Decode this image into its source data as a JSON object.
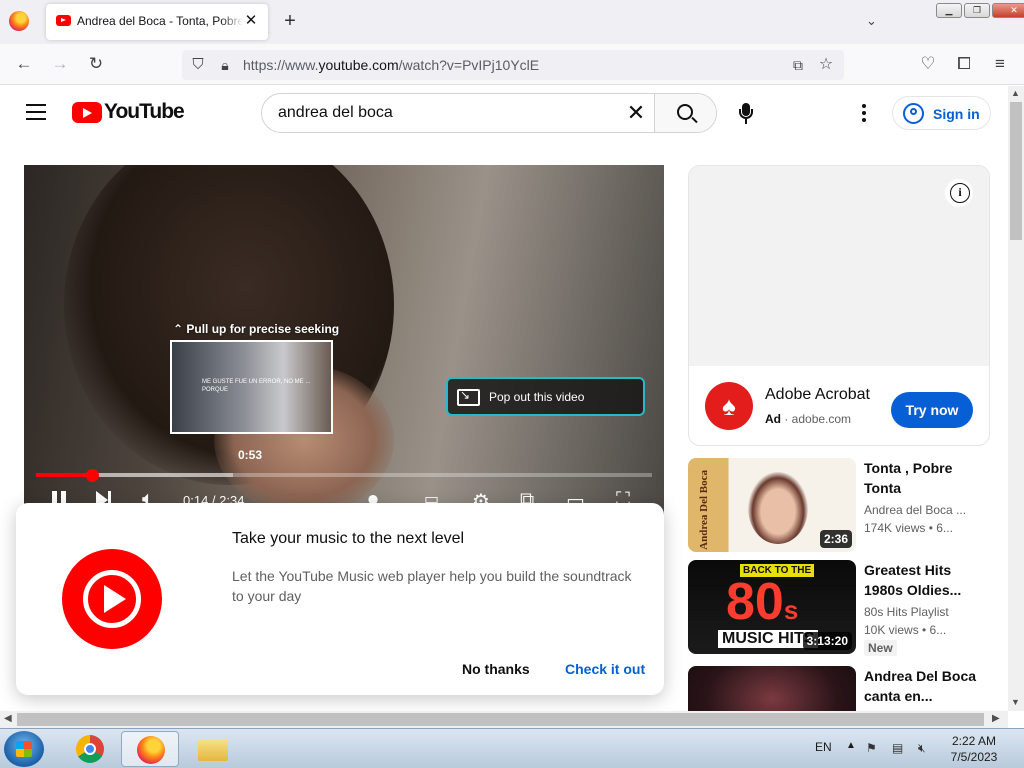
{
  "browser": {
    "tab_title": "Andrea del Boca - Tonta, Pobre",
    "url_prefix": "https://www.",
    "url_domain": "youtube.com",
    "url_suffix": "/watch?v=PvIPj10YclE"
  },
  "youtube": {
    "logo_text": "YouTube",
    "search_value": "andrea del boca",
    "sign_in_label": "Sign in"
  },
  "player": {
    "seek_hint": "Pull up for precise seeking",
    "preview_caption": "ME GUSTE FUE UN ERROR, NO ME ... PORQUE",
    "hover_time": "0:53",
    "popout_label": "Pop out this video",
    "time_display": "0:14 / 2:34",
    "played_fraction": 0.091,
    "buffered_fraction": 0.32
  },
  "promo": {
    "title": "Take your music to the next level",
    "body": "Let the YouTube Music web player help you build the soundtrack to your day",
    "dismiss_label": "No thanks",
    "confirm_label": "Check it out"
  },
  "ad": {
    "title": "Adobe Acrobat",
    "badge": "Ad",
    "domain": "adobe.com",
    "cta": "Try now"
  },
  "recommendations": [
    {
      "title": "Tonta , Pobre Tonta",
      "channel": "Andrea del Boca ...",
      "meta": "174K views  • 6...",
      "duration": "2:36",
      "thumb_text": "Andrea Del Boca"
    },
    {
      "title": "Greatest Hits 1980s Oldies...",
      "channel": "80s Hits Playlist",
      "meta": "10K views  • 6...",
      "duration": "3:13:20",
      "badge": "New",
      "thumb_top": "BACK TO THE",
      "thumb_big": "80",
      "thumb_suffix": "s",
      "thumb_bottom": "MUSIC HITS"
    },
    {
      "title": "Andrea Del Boca canta en..."
    }
  ],
  "taskbar": {
    "language": "EN",
    "time": "2:22 AM",
    "date": "7/5/2023"
  },
  "colors": {
    "youtube_red": "#ff0000",
    "link_blue": "#065fd4",
    "popout_outline": "#2ab8c8"
  }
}
